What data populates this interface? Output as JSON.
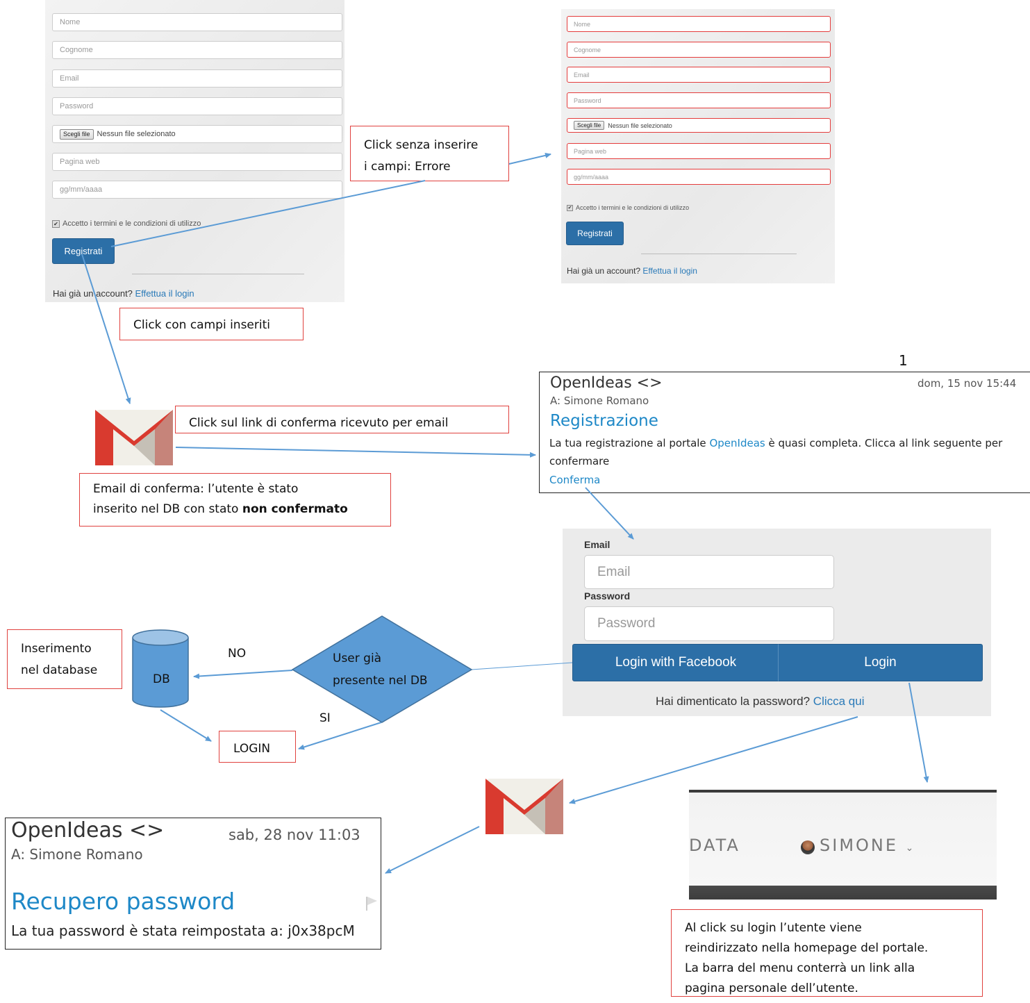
{
  "form_left": {
    "fields": [
      "Nome",
      "Cognome",
      "Email",
      "Password",
      "",
      "Pagina web",
      "gg/mm/aaaa"
    ],
    "file_button": "Scegli file",
    "file_text": "Nessun file selezionato",
    "terms": "Accetto i termini e le condizioni di utilizzo",
    "submit": "Registrati",
    "footer_text": "Hai già un account?",
    "footer_link": "Effettua il login"
  },
  "form_right": {
    "fields": [
      "Nome",
      "Cognome",
      "Email",
      "Password",
      "",
      "Pagina web",
      "gg/mm/aaaa"
    ],
    "file_button": "Scegli file",
    "file_text": "Nessun file selezionato",
    "terms": "Accetto i termini e le condizioni di utilizzo",
    "submit": "Registrati",
    "footer_text": "Hai già un account?",
    "footer_link": "Effettua il login"
  },
  "notes": {
    "click_error_line1": "Click senza inserire",
    "click_error_line2": "i campi: Errore",
    "click_filled": "Click con campi inseriti",
    "confirm_link": "Click sul link di conferma ricevuto per email",
    "confirm_email_line1": "Email di conferma: l’utente è stato",
    "confirm_email_line2": "inserito nel DB con stato",
    "confirm_email_bold": "non confermato",
    "insert_db_line1": "Inserimento",
    "insert_db_line2": "nel database",
    "login_box": "LOGIN",
    "final_line1": "Al click su login l’utente viene",
    "final_line2": "reindirizzato nella homepage del portale.",
    "final_line3": "La barra del menu conterrà un link alla",
    "final_line4": "pagina personale dell’utente."
  },
  "page_number": "1",
  "mail_confirm": {
    "from": "OpenIdeas <>",
    "to": "A:  Simone Romano",
    "date": "dom, 15 nov  15:44",
    "subject": "Registrazione",
    "body_pre": "La tua registrazione al portale",
    "body_link": "OpenIdeas",
    "body_post": "è quasi completa. Clicca al link seguente per",
    "body_line2": "confermare",
    "confirm_link": "Conferma"
  },
  "login_form": {
    "email_label": "Email",
    "email_placeholder": "Email",
    "password_label": "Password",
    "password_placeholder": "Password",
    "facebook_button": "Login with Facebook",
    "login_button": "Login",
    "forgot_text": "Hai dimenticato la password?",
    "forgot_link": "Clicca qui"
  },
  "flowchart": {
    "db_label": "DB",
    "decision_line1": "User già",
    "decision_line2": "presente nel DB",
    "no_label": "NO",
    "si_label": "SI"
  },
  "menu_bar": {
    "left_item": "DATA",
    "user_item": "SIMONE"
  },
  "mail_recovery": {
    "from": "OpenIdeas <>",
    "to": "A:  Simone Romano",
    "date": "sab, 28 nov  11:03",
    "subject": "Recupero password",
    "body": "La tua password è stata reimpostata a: j0x38pcM"
  },
  "colors": {
    "arrow": "#5b9bd5",
    "note_border": "#e0413e",
    "button_blue": "#2c6fa7",
    "flow_fill": "#5b9bd5",
    "link": "#1e88c7"
  }
}
